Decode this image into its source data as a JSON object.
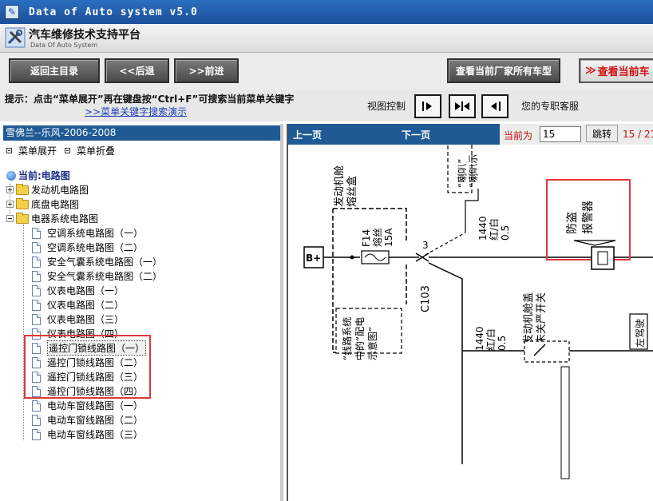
{
  "window": {
    "title": "Data of Auto system v5.0"
  },
  "logo": {
    "cn": "汽车维修技术支持平台",
    "en": "Data Of Auto System"
  },
  "toolbar": {
    "home": "返回主目录",
    "back": "<<后退",
    "forward": ">>前进",
    "all_models": "查看当前厂家所有车型",
    "current_model": "查看当前车"
  },
  "hint": {
    "text": "提示：点击“菜单展开”再在键盘按“Ctrl+F”可搜索当前菜单关键字",
    "link": ">>菜单关键字搜索演示",
    "view_label": "视图控制",
    "service": "您的专职客服"
  },
  "left": {
    "car": "雪佛兰--乐风-2006-2008",
    "expand": "菜单展开",
    "collapse": "菜单折叠",
    "current": "当前:电路图",
    "folders": [
      {
        "label": "发动机电路图",
        "expanded": false
      },
      {
        "label": "底盘电路图",
        "expanded": false
      },
      {
        "label": "电器系统电路图",
        "expanded": true
      }
    ],
    "items": [
      "空调系统电路图（一）",
      "空调系统电路图（二）",
      "安全气囊系统电路图（一）",
      "安全气囊系统电路图（二）",
      "仪表电路图（一）",
      "仪表电路图（二）",
      "仪表电路图（三）",
      "仪表电路图（四）",
      "遥控门锁线路图（一）",
      "遥控门锁线路图（二）",
      "遥控门锁线路图（三）",
      "遥控门锁线路图（四）",
      "电动车窗线路图（一）",
      "电动车窗线路图（二）",
      "电动车窗线路图（三）"
    ],
    "selected_index": 8
  },
  "viewer": {
    "prev": "上一页",
    "next": "下一页",
    "current_label": "当前为",
    "page_value": "15",
    "go": "跳转",
    "count": "15 / 21"
  },
  "diagram": {
    "fuse_box_label": "发动机舱\n熔丝盒",
    "horn_label": "“喇叭”\n“喇叭示",
    "fuse_name": "F14",
    "fuse_word": "熔丝",
    "fuse_amp": "15A",
    "bplus": "B+",
    "connector": "C103",
    "pin": "3",
    "wire_top": "1440\n红/白\n0.5",
    "wire_bottom": "1440\n红/白\n0.5",
    "alarm": "防盗\n报警器",
    "hood_switch": "发动机舱盖\n未关严开关",
    "power_ref": "“线路系统\n中的“配电\n示意图”",
    "left_driver": "左驾驶"
  },
  "colors": {
    "accent_blue": "#1f5a95",
    "highlight_red": "#e0383a"
  }
}
